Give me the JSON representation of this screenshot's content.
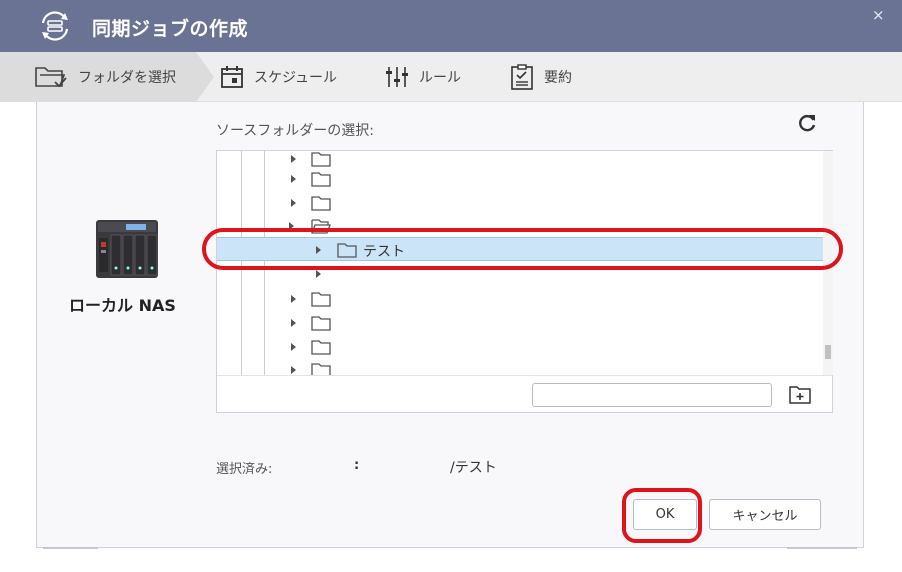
{
  "window": {
    "title": "同期ジョブの作成",
    "close_glyph": "×"
  },
  "steps": [
    {
      "label": "フォルダを選択",
      "icon": "folder-check-icon",
      "active": true
    },
    {
      "label": "スケジュール",
      "icon": "calendar-icon",
      "active": false
    },
    {
      "label": "ルール",
      "icon": "sliders-icon",
      "active": false
    },
    {
      "label": "要約",
      "icon": "clipboard-icon",
      "active": false
    }
  ],
  "device": {
    "label": "ローカル NAS",
    "icon": "nas-icon"
  },
  "source": {
    "label": "ソースフォルダーの選択:",
    "tree": {
      "rows": [
        {
          "name": "",
          "depth": 0,
          "selected": false
        },
        {
          "name": "",
          "depth": 0,
          "selected": false
        },
        {
          "name": "",
          "depth": 0,
          "selected": false
        },
        {
          "name": "",
          "depth": 0,
          "open": true,
          "selected": false
        },
        {
          "name": "テスト",
          "depth": 1,
          "selected": true
        },
        {
          "name": "",
          "depth": 1,
          "selected": false
        },
        {
          "name": "",
          "depth": 0,
          "selected": false
        },
        {
          "name": "",
          "depth": 0,
          "selected": false
        },
        {
          "name": "",
          "depth": 0,
          "selected": false
        },
        {
          "name": "",
          "depth": 0,
          "selected": false
        }
      ]
    },
    "new_folder_input": {
      "value": "",
      "placeholder": ""
    }
  },
  "selected": {
    "label": "選択済み:",
    "separator": ":",
    "value": "/テスト"
  },
  "buttons": {
    "ok": "OK",
    "cancel": "キャンセル"
  },
  "colors": {
    "titlebar": "#6b7394",
    "selection": "#cce4f7",
    "highlight": "#e0121a"
  }
}
